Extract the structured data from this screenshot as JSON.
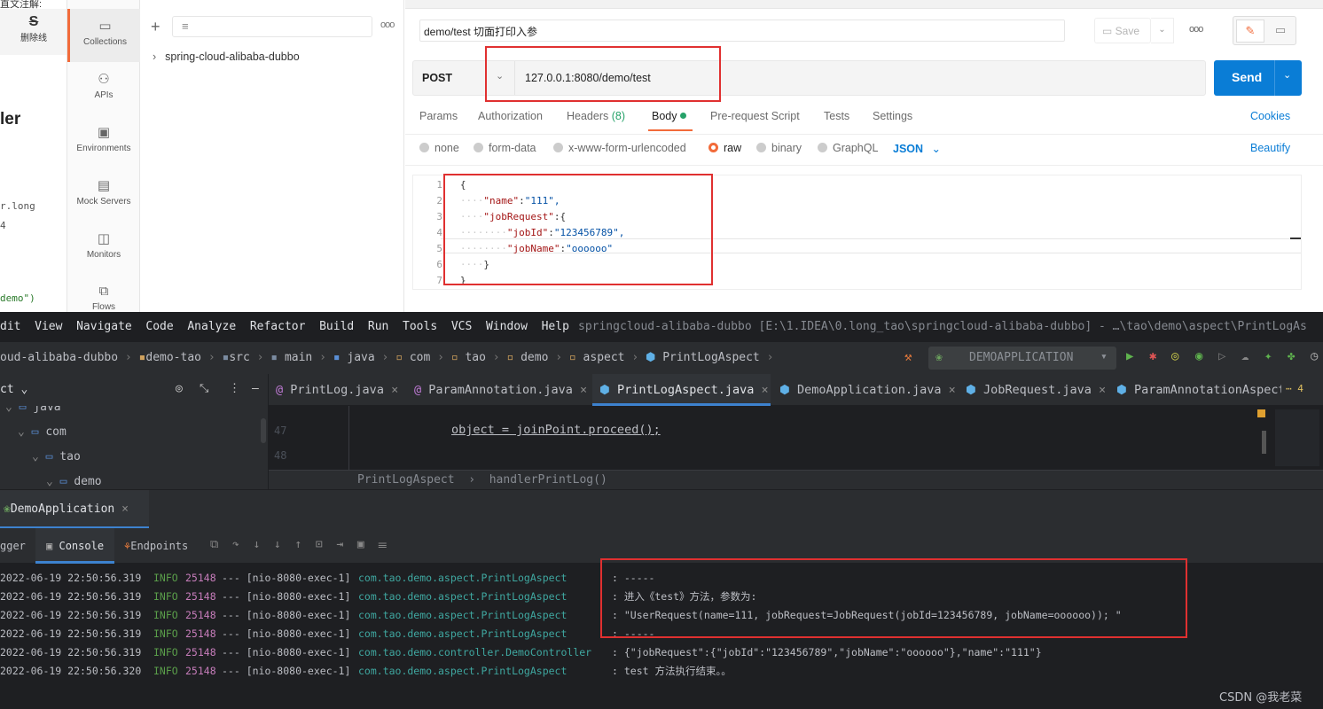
{
  "leftdoc": {
    "top_text": "直文注解:",
    "strike_label": "删除线",
    "heading": "ler",
    "code1": "r.long",
    "code2": "4",
    "code3": "demo\")"
  },
  "sidebar": {
    "items": [
      {
        "label": "Collections",
        "icon": "collections-icon"
      },
      {
        "label": "APIs",
        "icon": "apis-icon"
      },
      {
        "label": "Environments",
        "icon": "environments-icon"
      },
      {
        "label": "Mock Servers",
        "icon": "mock-servers-icon"
      },
      {
        "label": "Monitors",
        "icon": "monitors-icon"
      },
      {
        "label": "Flows",
        "icon": "flows-icon"
      }
    ]
  },
  "collections": {
    "tree_item": "spring-cloud-alibaba-dubbo",
    "more": "ooo"
  },
  "request": {
    "name": "demo/test 切面打印入参",
    "save": "Save",
    "more": "ooo",
    "method": "POST",
    "url": "127.0.0.1:8080/demo/test",
    "send": "Send",
    "tabs": [
      "Params",
      "Authorization",
      "Headers",
      "Body",
      "Pre-request Script",
      "Tests",
      "Settings"
    ],
    "headers_count": "(8)",
    "cookies": "Cookies",
    "body_types": [
      "none",
      "form-data",
      "x-www-form-urlencoded",
      "raw",
      "binary",
      "GraphQL"
    ],
    "format": "JSON",
    "beautify": "Beautify",
    "body_lines": [
      {
        "n": "1",
        "t": "{"
      },
      {
        "n": "2",
        "k": "\"name\"",
        "v": "\"111\","
      },
      {
        "n": "3",
        "k": "\"jobRequest\"",
        "v": "{"
      },
      {
        "n": "4",
        "k": "\"jobId\"",
        "v": "\"123456789\","
      },
      {
        "n": "5",
        "k": "\"jobName\"",
        "v": "\"oooooo\""
      },
      {
        "n": "6",
        "t": "}"
      },
      {
        "n": "7",
        "t": "}"
      }
    ]
  },
  "ide": {
    "menu": [
      "dit",
      "View",
      "Navigate",
      "Code",
      "Analyze",
      "Refactor",
      "Build",
      "Run",
      "Tools",
      "VCS",
      "Window",
      "Help"
    ],
    "project_title": "springcloud-alibaba-dubbo [E:\\1.IDEA\\0.long_tao\\springcloud-alibaba-dubbo] - …\\tao\\demo\\aspect\\PrintLogAs",
    "crumbs": [
      "oud-alibaba-dubbo",
      "demo-tao",
      "src",
      "main",
      "java",
      "com",
      "tao",
      "demo",
      "aspect",
      "PrintLogAspect"
    ],
    "run_config": "DEMOAPPLICATION",
    "project_label": "ct",
    "tree": [
      "java",
      "com",
      "tao",
      "demo"
    ],
    "tabs": [
      "PrintLog.java",
      "ParamAnnotation.java",
      "PrintLogAspect.java",
      "DemoApplication.java",
      "JobRequest.java",
      "ParamAnnotationAspect"
    ],
    "tabs_more": "4",
    "code_lines": [
      {
        "n": "47",
        "code": "object = joinPoint.proceed();"
      },
      {
        "n": "48",
        "code": ""
      }
    ],
    "code_crumb": [
      "PrintLogAspect",
      "handlerPrintLog()"
    ],
    "run_tab": "DemoApplication",
    "console_tabs": [
      "gger",
      "Console",
      "Endpoints"
    ],
    "logs": [
      {
        "ts": "2022-06-19 22:50:56.319",
        "lvl": "INFO",
        "pid": "25148",
        "th": "--- [nio-8080-exec-1]",
        "cls": "com.tao.demo.aspect.PrintLogAspect",
        "msg": ": -----"
      },
      {
        "ts": "2022-06-19 22:50:56.319",
        "lvl": "INFO",
        "pid": "25148",
        "th": "--- [nio-8080-exec-1]",
        "cls": "com.tao.demo.aspect.PrintLogAspect",
        "msg": ": 进入《test》方法，参数为:"
      },
      {
        "ts": "2022-06-19 22:50:56.319",
        "lvl": "INFO",
        "pid": "25148",
        "th": "--- [nio-8080-exec-1]",
        "cls": "com.tao.demo.aspect.PrintLogAspect",
        "msg": ": \"UserRequest(name=111, jobRequest=JobRequest(jobId=123456789, jobName=oooooo)); \""
      },
      {
        "ts": "2022-06-19 22:50:56.319",
        "lvl": "INFO",
        "pid": "25148",
        "th": "--- [nio-8080-exec-1]",
        "cls": "com.tao.demo.aspect.PrintLogAspect",
        "msg": ": -----"
      },
      {
        "ts": "2022-06-19 22:50:56.319",
        "lvl": "INFO",
        "pid": "25148",
        "th": "--- [nio-8080-exec-1]",
        "cls": "com.tao.demo.controller.DemoController",
        "msg": ": {\"jobRequest\":{\"jobId\":\"123456789\",\"jobName\":\"oooooo\"},\"name\":\"111\"}"
      },
      {
        "ts": "2022-06-19 22:50:56.320",
        "lvl": "INFO",
        "pid": "25148",
        "th": "--- [nio-8080-exec-1]",
        "cls": "com.tao.demo.aspect.PrintLogAspect",
        "msg": ": test 方法执行结束。。"
      }
    ]
  },
  "watermark": "CSDN @我老菜",
  "colors": {
    "accent": "#f26b3a",
    "send": "#0a7dd6",
    "highlight_box": "#e03030"
  }
}
